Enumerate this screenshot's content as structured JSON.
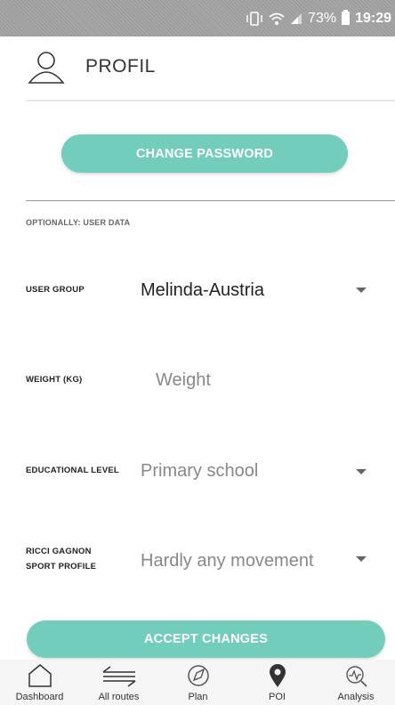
{
  "status_bar": {
    "battery": "73%",
    "time": "19:29"
  },
  "header": {
    "title": "PROFIL"
  },
  "change_password_label": "CHANGE PASSWORD",
  "section_title": "OPTIONALLY: USER DATA",
  "fields": {
    "user_group": {
      "label": "USER GROUP",
      "value": "Melinda-Austria"
    },
    "weight": {
      "label": "WEIGHT (KG)",
      "placeholder": "Weight"
    },
    "educational_level": {
      "label": "EDUCATIONAL LEVEL",
      "value": "Primary school"
    },
    "sport_profile": {
      "label_line1": "RICCI GAGNON",
      "label_line2": "SPORT PROFILE",
      "value": "Hardly any movement"
    }
  },
  "accept_label": "ACCEPT CHANGES",
  "nav": {
    "items": [
      {
        "label": "Dashboard",
        "icon": "home-icon"
      },
      {
        "label": "All routes",
        "icon": "routes-icon"
      },
      {
        "label": "Plan",
        "icon": "compass-icon"
      },
      {
        "label": "POI",
        "icon": "location-pin-icon"
      },
      {
        "label": "Analysis",
        "icon": "analysis-icon"
      }
    ]
  },
  "colors": {
    "accent": "#72cdbc",
    "statusbar": "#a0a0a0"
  }
}
